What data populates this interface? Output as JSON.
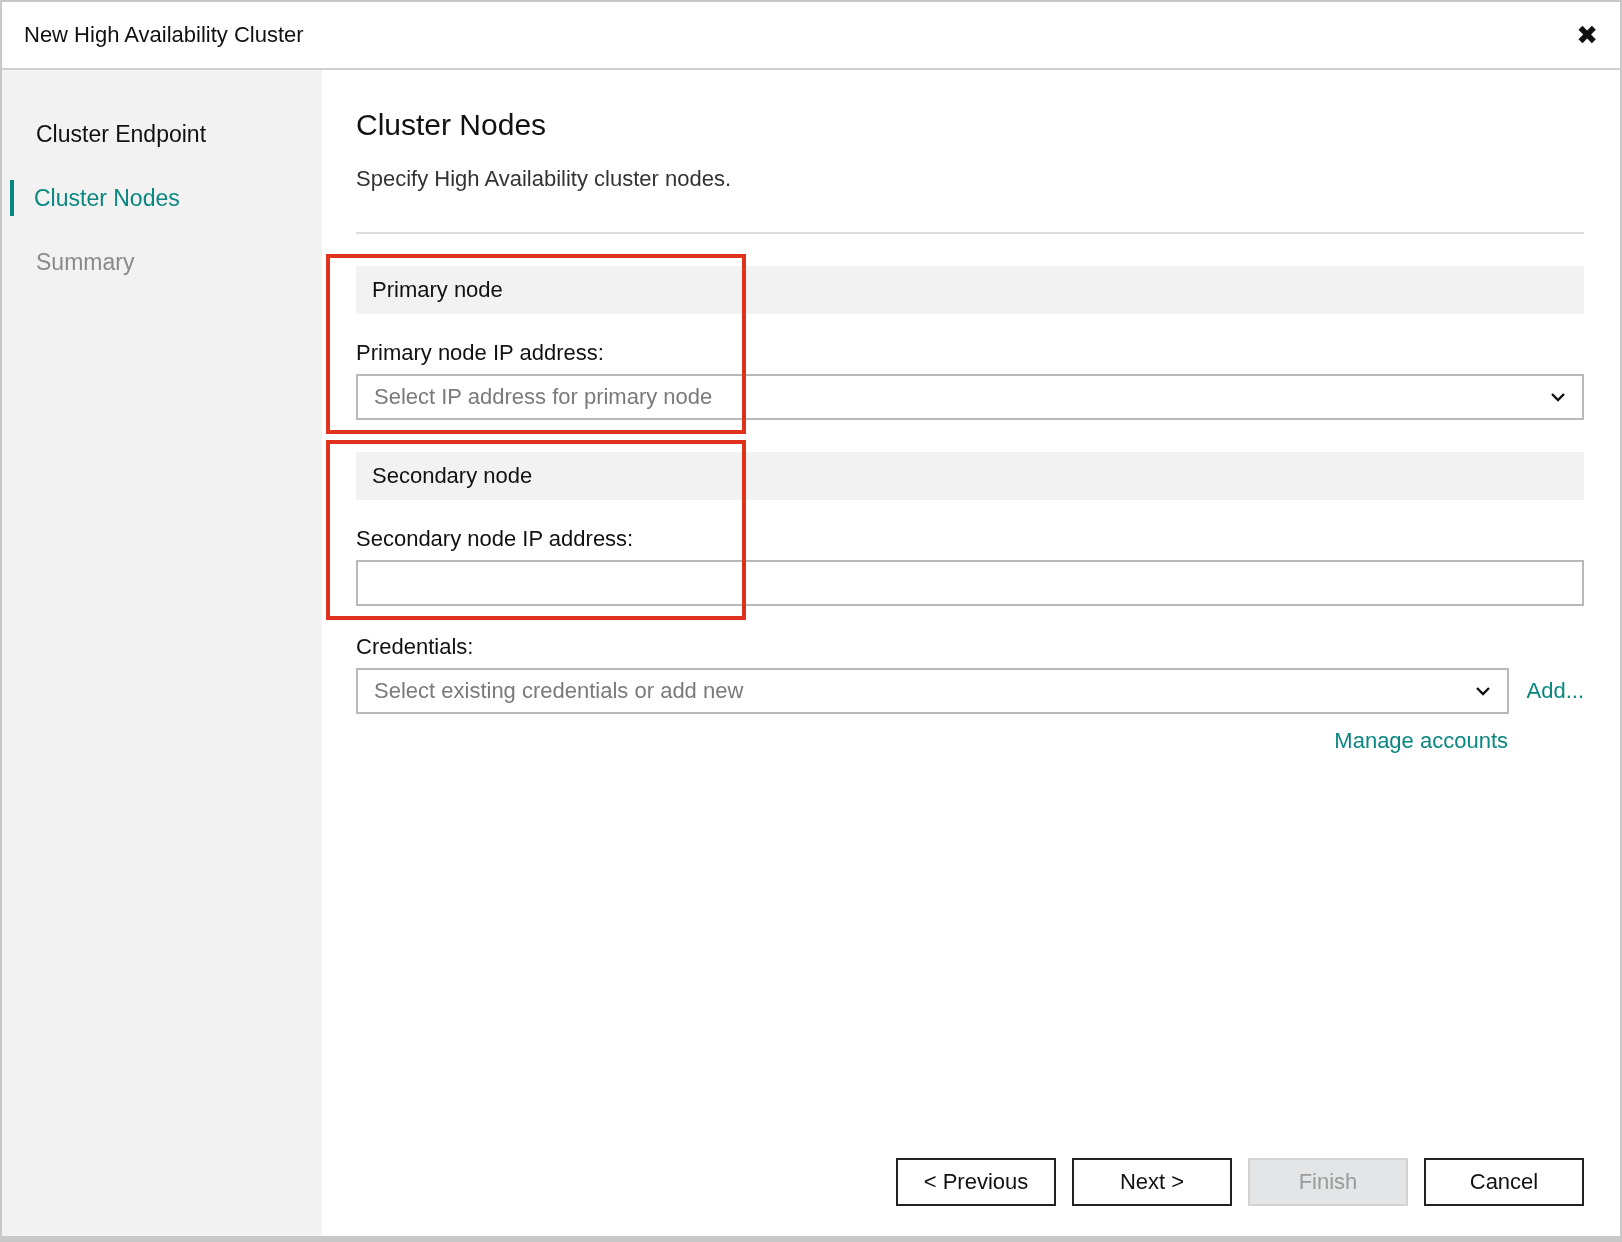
{
  "window": {
    "title": "New High Availability Cluster",
    "close": "✖"
  },
  "sidebar": {
    "items": [
      {
        "label": "Cluster Endpoint",
        "selected": false,
        "disabled": false
      },
      {
        "label": "Cluster Nodes",
        "selected": true,
        "disabled": false
      },
      {
        "label": "Summary",
        "selected": false,
        "disabled": true
      }
    ]
  },
  "page": {
    "title": "Cluster Nodes",
    "subtitle": "Specify High Availability cluster nodes.",
    "sections": [
      {
        "header": "Primary node",
        "highlighted": true,
        "fields": [
          {
            "label": "Primary node IP address:",
            "kind": "dropdown",
            "placeholder": "Select IP address for primary node"
          }
        ]
      },
      {
        "header": "Secondary node",
        "highlighted": true,
        "fields": [
          {
            "label": "Secondary node IP address:",
            "kind": "text"
          }
        ]
      }
    ],
    "credentials": {
      "label": "Credentials:",
      "kind": "dropdown",
      "placeholder": "Select existing credentials or add new",
      "add_link": "Add...",
      "manage_link": "Manage accounts"
    }
  },
  "buttons": [
    {
      "label": "< Previous",
      "disabled": false
    },
    {
      "label": "Next >",
      "disabled": false
    },
    {
      "label": "Finish",
      "disabled": true
    },
    {
      "label": "Cancel",
      "disabled": false
    }
  ]
}
